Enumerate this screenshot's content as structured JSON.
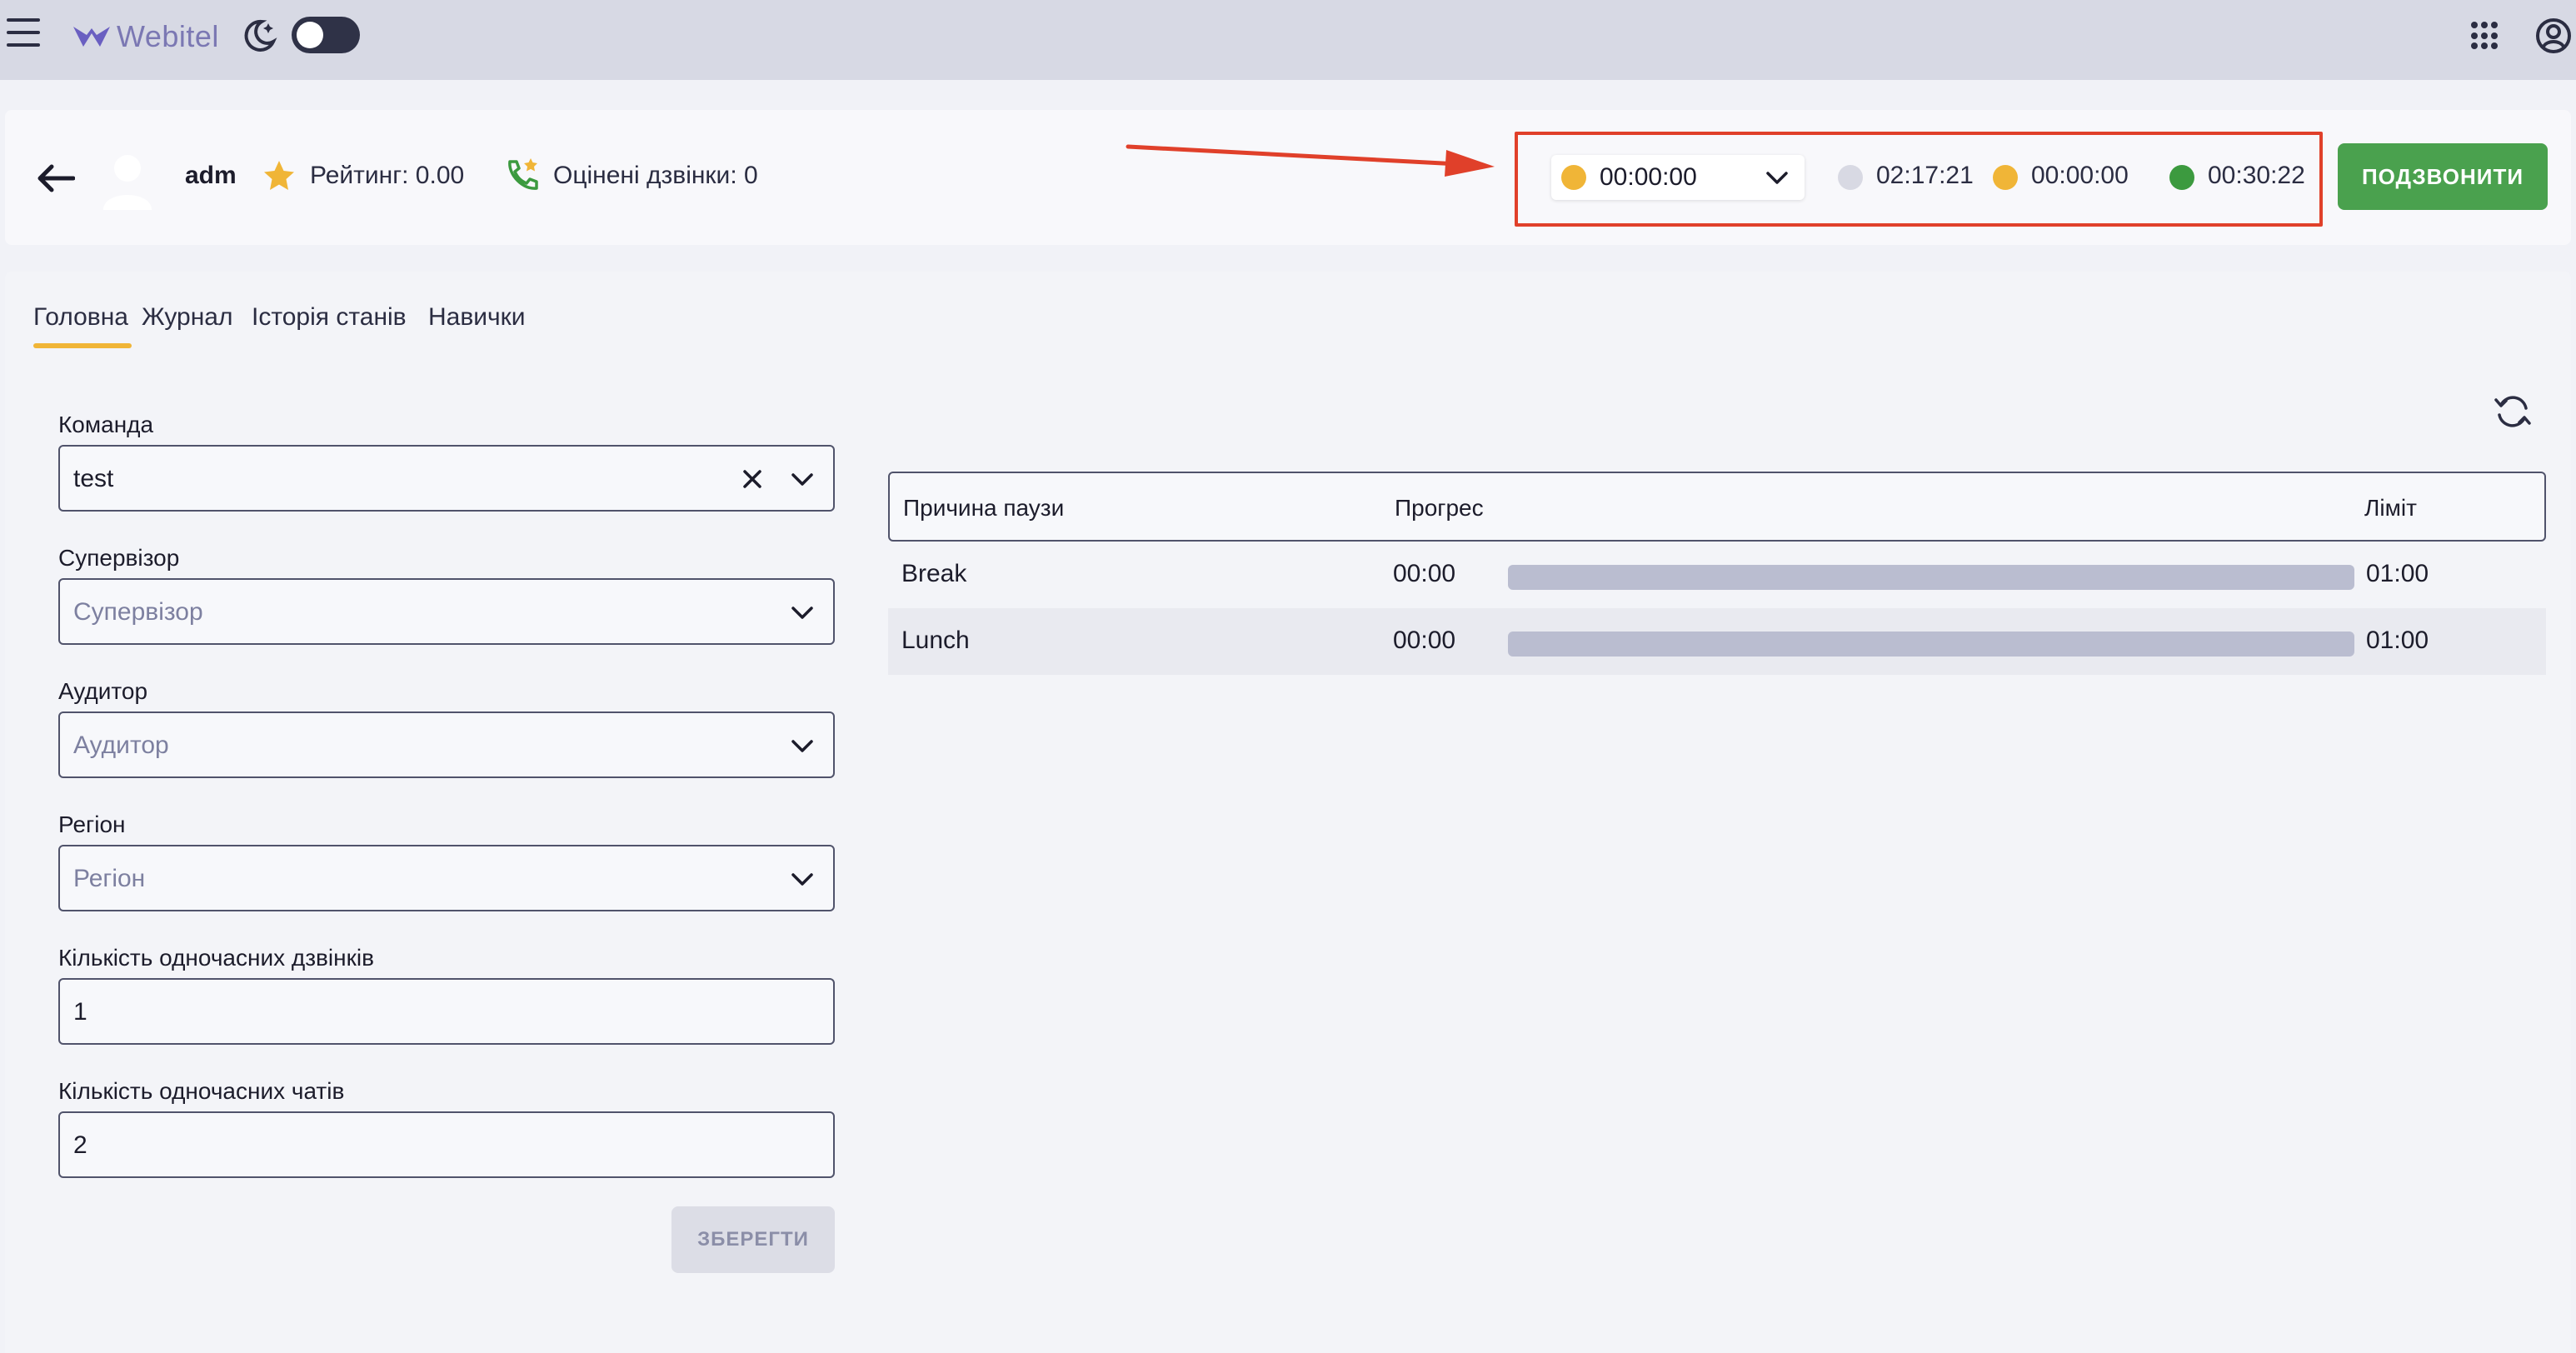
{
  "appbar": {
    "brand": "Webitel",
    "theme_toggle": "off"
  },
  "agent": {
    "name": "adm",
    "rating": "Рейтинг: 0.00",
    "rated_calls": "Оцінені дзвінки: 0"
  },
  "status": {
    "current_time": "00:00:00",
    "current_color": "#f0b537",
    "stats": [
      {
        "time": "02:17:21",
        "color": "#d8d9e3"
      },
      {
        "time": "00:00:00",
        "color": "#f0b537"
      },
      {
        "time": "00:30:22",
        "color": "#3c9a3f"
      }
    ]
  },
  "call_button": "ПОДЗВОНИТИ",
  "tabs": [
    "Головна",
    "Журнал",
    "Історія станів",
    "Навички"
  ],
  "active_tab": "Головна",
  "form": {
    "team": {
      "label": "Команда",
      "value": "test"
    },
    "supervisor": {
      "label": "Супервізор",
      "placeholder": "Супервізор"
    },
    "auditor": {
      "label": "Аудитор",
      "placeholder": "Аудитор"
    },
    "region": {
      "label": "Регіон",
      "placeholder": "Регіон"
    },
    "concurrent_calls": {
      "label": "Кількість одночасних дзвінків",
      "value": "1"
    },
    "concurrent_chats": {
      "label": "Кількість одночасних чатів",
      "value": "2"
    },
    "save_label": "ЗБЕРЕГТИ"
  },
  "pause_table": {
    "headers": {
      "reason": "Причина паузи",
      "progress": "Прогрес",
      "limit": "Ліміт"
    },
    "rows": [
      {
        "reason": "Break",
        "spent": "00:00",
        "limit": "01:00",
        "progress": 0
      },
      {
        "reason": "Lunch",
        "spent": "00:00",
        "limit": "01:00",
        "progress": 0
      }
    ]
  },
  "colors": {
    "accent": "#f0b537",
    "call_green": "#4aa14e",
    "annotation_red": "#e0402a"
  }
}
